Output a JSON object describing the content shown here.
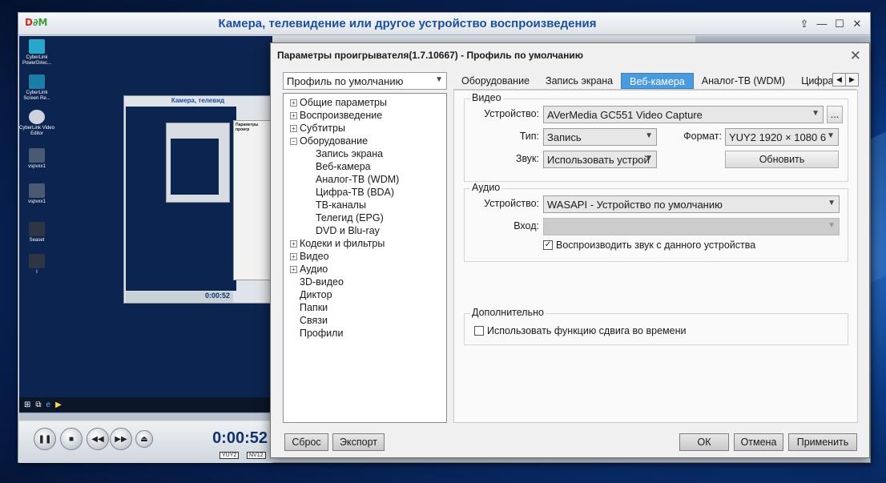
{
  "player": {
    "title": "Камера, телевидение или другое устройство воспроизведения",
    "logo_d": "D",
    "logo_pm": "∂M",
    "time": "0:00:52",
    "fmt_video": "YUY2",
    "fmt_audio": "NV12",
    "nested_title": "Камера, телевид",
    "nested_time": "0:00:52",
    "nested_dialog_title": "Параметры проигр",
    "desktop_icons": [
      "CyberLink PowerDirec...",
      "CyberLink Screen Re...",
      "CyberLink Video Editor",
      "vspvxx1",
      "vspvxx1",
      "Seaset",
      "I"
    ]
  },
  "dialog": {
    "title": "Параметры проигрывателя(1.7.10667) - Профиль по умолчанию",
    "profile": "Профиль по умолчанию",
    "tree": [
      {
        "label": "Общие параметры",
        "toggle": "+",
        "level": 0
      },
      {
        "label": "Воспроизведение",
        "toggle": "+",
        "level": 0
      },
      {
        "label": "Субтитры",
        "toggle": "+",
        "level": 0
      },
      {
        "label": "Оборудование",
        "toggle": "−",
        "level": 0
      },
      {
        "label": "Запись экрана",
        "toggle": "",
        "level": 1
      },
      {
        "label": "Веб-камера",
        "toggle": "",
        "level": 1
      },
      {
        "label": "Аналог-ТВ (WDM)",
        "toggle": "",
        "level": 1
      },
      {
        "label": "Цифра-ТВ (BDA)",
        "toggle": "",
        "level": 1
      },
      {
        "label": "ТВ-каналы",
        "toggle": "",
        "level": 1
      },
      {
        "label": "Телегид (EPG)",
        "toggle": "",
        "level": 1
      },
      {
        "label": "DVD и Blu-ray",
        "toggle": "",
        "level": 1
      },
      {
        "label": "Кодеки и фильтры",
        "toggle": "+",
        "level": 0
      },
      {
        "label": "Видео",
        "toggle": "+",
        "level": 0
      },
      {
        "label": "Аудио",
        "toggle": "+",
        "level": 0
      },
      {
        "label": "3D-видео",
        "toggle": "",
        "level": 0
      },
      {
        "label": "Диктор",
        "toggle": "",
        "level": 0
      },
      {
        "label": "Папки",
        "toggle": "",
        "level": 0
      },
      {
        "label": "Связи",
        "toggle": "",
        "level": 0
      },
      {
        "label": "Профили",
        "toggle": "",
        "level": 0
      }
    ],
    "tabs": [
      "Оборудование",
      "Запись экрана",
      "Веб-камера",
      "Аналог-ТВ (WDM)",
      "Цифра-Т"
    ],
    "active_tab": "Веб-камера",
    "video": {
      "group": "Видео",
      "device_label": "Устройство:",
      "device_value": "AVerMedia GC551 Video Capture",
      "browse": "...",
      "type_label": "Тип:",
      "type_value": "Запись",
      "format_label": "Формат:",
      "format_value": "YUY2 1920 × 1080 6",
      "sound_label": "Звук:",
      "sound_value": "Использовать устрой",
      "refresh": "Обновить"
    },
    "audio": {
      "group": "Аудио",
      "device_label": "Устройство:",
      "device_value": "WASAPI - Устройство по умолчанию",
      "input_label": "Вход:",
      "input_value": "",
      "play_sound_label": "Воспроизводить звук с данного устройства",
      "play_sound_checked": true
    },
    "extra": {
      "group": "Дополнительно",
      "timeshift_label": "Использовать функцию сдвига во времени",
      "timeshift_checked": false
    },
    "buttons": {
      "reset": "Сброс",
      "export": "Экспорт",
      "ok": "ОК",
      "cancel": "Отмена",
      "apply": "Применить"
    }
  },
  "colors": {
    "accent": "#4a9bde",
    "title_blue": "#1c4f9c",
    "desktop": "#0b3b86"
  }
}
